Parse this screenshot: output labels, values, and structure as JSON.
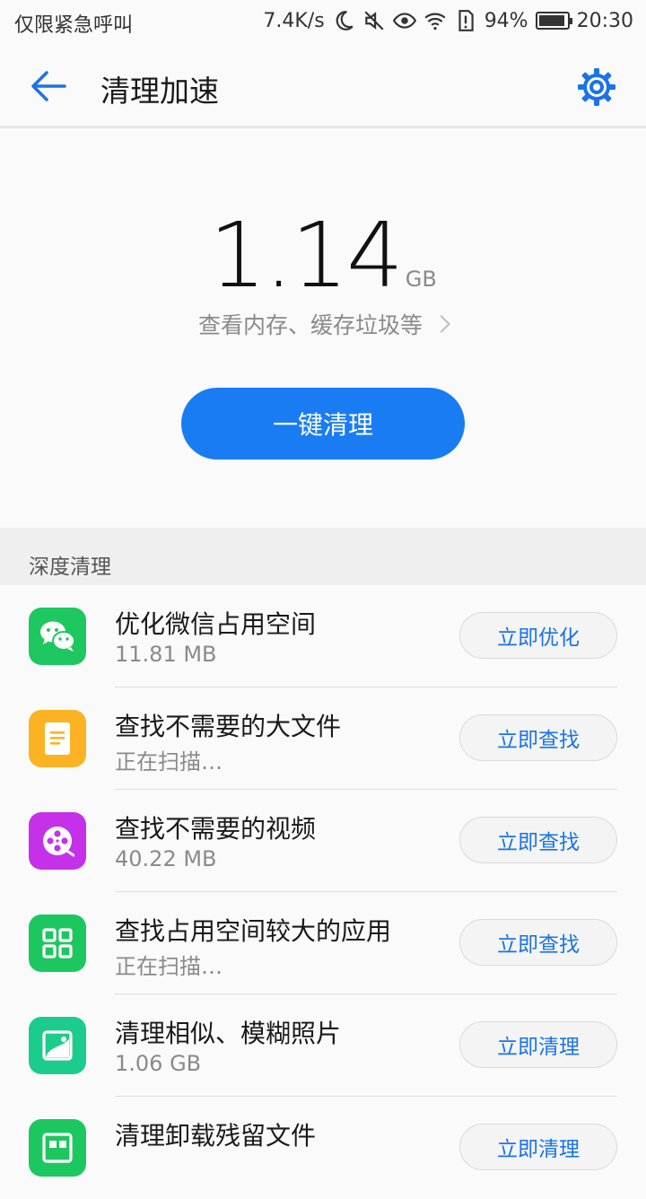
{
  "status_bar": {
    "left_text": "仅限紧急呼叫",
    "network_speed": "7.4K/s",
    "battery_percent": "94%",
    "time": "20:30",
    "battery_level": 0.94,
    "icons": [
      "moon-icon",
      "mute-icon",
      "eye-icon",
      "wifi-icon",
      "sim-alert-icon",
      "battery-icon"
    ]
  },
  "header": {
    "title": "清理加速"
  },
  "hero": {
    "size_value": "1.14",
    "size_unit": "GB",
    "detail_link": "查看内存、缓存垃圾等",
    "clean_button": "一键清理"
  },
  "section": {
    "title": "深度清理"
  },
  "items": [
    {
      "title": "优化微信占用空间",
      "sub": "11.81 MB",
      "button": "立即优化",
      "icon": "wechat-icon",
      "color": "#1fc760"
    },
    {
      "title": "查找不需要的大文件",
      "sub": "正在扫描…",
      "button": "立即查找",
      "icon": "document-icon",
      "color": "#fbb324"
    },
    {
      "title": "查找不需要的视频",
      "sub": "40.22 MB",
      "button": "立即查找",
      "icon": "film-reel-icon",
      "color": "#c531e8"
    },
    {
      "title": "查找占用空间较大的应用",
      "sub": "正在扫描…",
      "button": "立即查找",
      "icon": "apps-grid-icon",
      "color": "#1dc760"
    },
    {
      "title": "清理相似、模糊照片",
      "sub": "1.06 GB",
      "button": "立即清理",
      "icon": "photo-icon",
      "color": "#1ccc8c"
    },
    {
      "title": "清理卸载残留文件",
      "sub": "",
      "button": "立即清理",
      "icon": "uninstall-residue-icon",
      "color": "#1dc760"
    }
  ],
  "colors": {
    "accent": "#1a7cf3",
    "link": "#1a73e8"
  }
}
